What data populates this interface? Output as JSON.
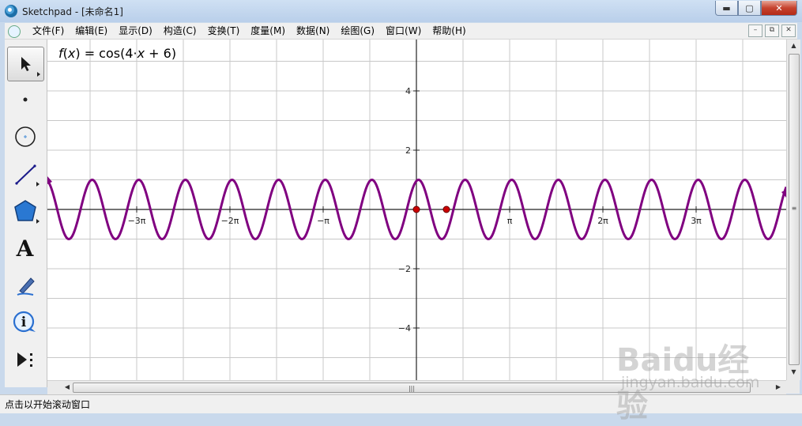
{
  "window": {
    "title": "Sketchpad  - [未命名1]",
    "minimize_glyph": "▬",
    "maximize_glyph": "▢",
    "close_glyph": "✕"
  },
  "menu": {
    "items": [
      "文件(F)",
      "编辑(E)",
      "显示(D)",
      "构造(C)",
      "变换(T)",
      "度量(M)",
      "数据(N)",
      "绘图(G)",
      "窗口(W)",
      "帮助(H)"
    ],
    "mdi_minimize": "–",
    "mdi_restore": "⧉",
    "mdi_close": "✕"
  },
  "toolbox": {
    "tools": [
      {
        "name": "selection-arrow-tool",
        "icon": "arrow-icon",
        "active": true
      },
      {
        "name": "point-tool",
        "icon": "point-icon"
      },
      {
        "name": "compass-tool",
        "icon": "circle-icon"
      },
      {
        "name": "straightedge-tool",
        "icon": "segment-icon"
      },
      {
        "name": "polygon-tool",
        "icon": "polygon-icon"
      },
      {
        "name": "text-tool",
        "icon": "text-icon"
      },
      {
        "name": "marker-tool",
        "icon": "marker-icon"
      },
      {
        "name": "information-tool",
        "icon": "info-icon"
      },
      {
        "name": "custom-tool",
        "icon": "custom-tool-icon"
      }
    ],
    "text_tool_glyph": "A",
    "info_tool_glyph": "i"
  },
  "function_label": {
    "fname": "f",
    "var": "x",
    "mid": ") = cos(4·",
    "end": " + 6)"
  },
  "graph": {
    "x_tick_labels": [
      "−3π",
      "−2π",
      "−π",
      "π",
      "2π",
      "3π"
    ],
    "y_tick_labels": [
      "4",
      "2",
      "−2",
      "−4"
    ],
    "curve_color": "#800080",
    "point_color": "#cc0000",
    "grid_color": "#c8c8c8"
  },
  "status_bar": {
    "text": "点击以开始滚动窗口"
  },
  "watermark": {
    "brand": "Baidu经验",
    "url": "jingyan.baidu.com"
  }
}
